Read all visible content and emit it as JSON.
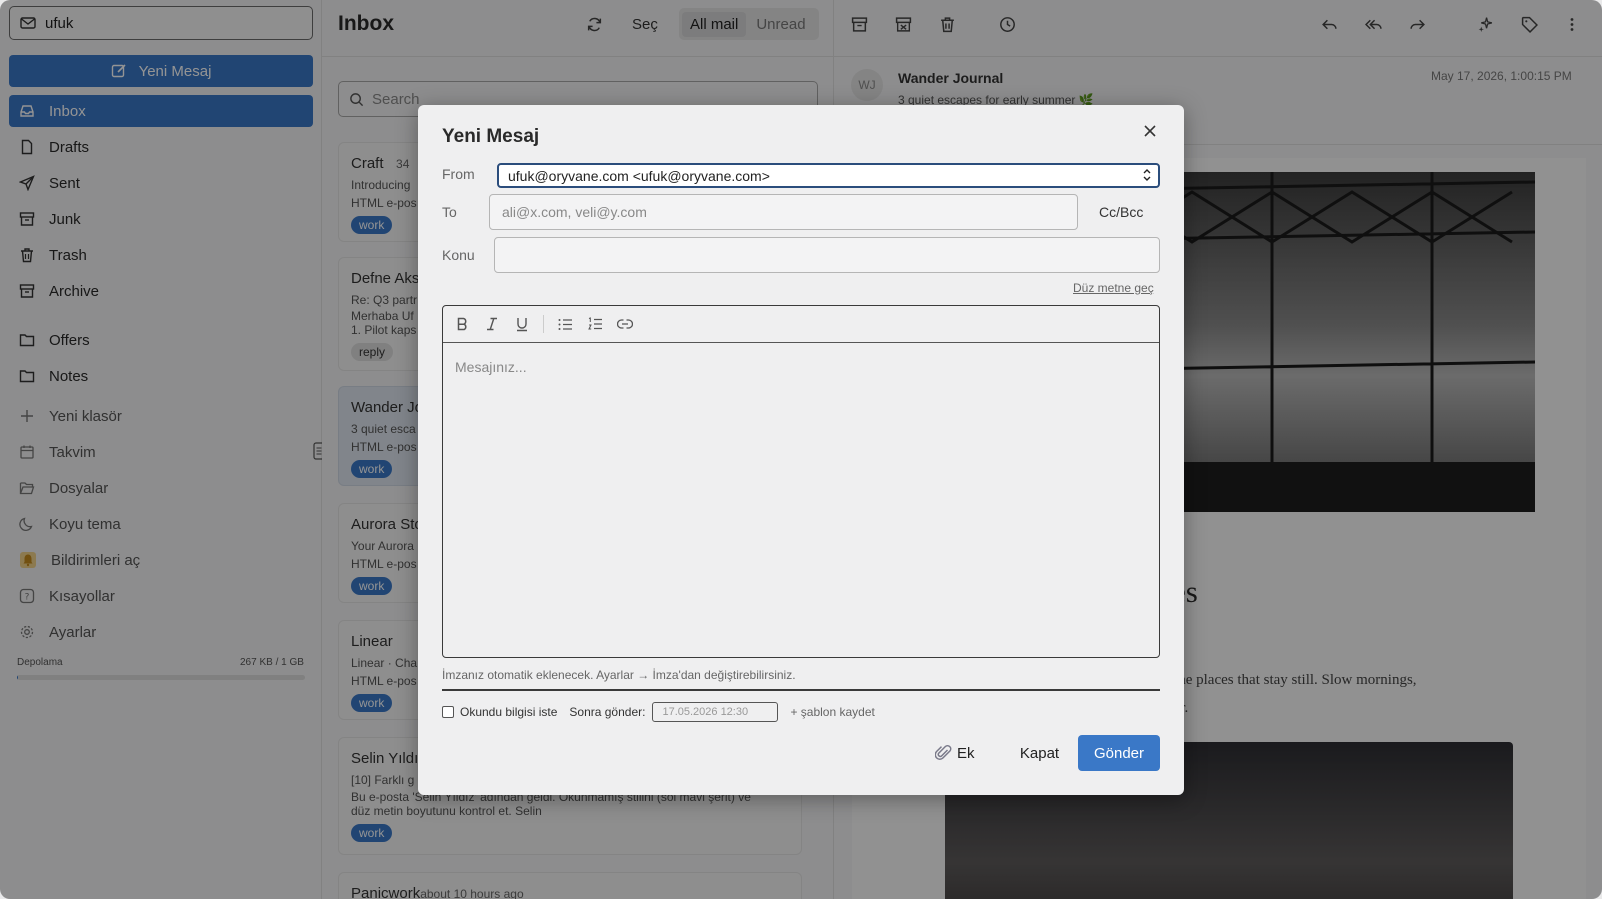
{
  "sidebar": {
    "account": "ufuk",
    "compose_label": "Yeni Mesaj",
    "folders": [
      {
        "label": "Inbox",
        "icon": "inbox-icon"
      },
      {
        "label": "Drafts",
        "icon": "file-icon"
      },
      {
        "label": "Sent",
        "icon": "send-icon"
      },
      {
        "label": "Junk",
        "icon": "junk-icon"
      },
      {
        "label": "Trash",
        "icon": "trash-icon"
      },
      {
        "label": "Archive",
        "icon": "archive-icon"
      }
    ],
    "custom_folders": [
      {
        "label": "Offers",
        "icon": "folder-icon"
      },
      {
        "label": "Notes",
        "icon": "folder-icon"
      }
    ],
    "actions": [
      {
        "label": "Yeni klasör",
        "icon": "plus-icon"
      },
      {
        "label": "Takvim",
        "icon": "calendar-icon"
      },
      {
        "label": "Dosyalar",
        "icon": "folder-open-icon"
      },
      {
        "label": "Koyu tema",
        "icon": "moon-icon"
      },
      {
        "label": "Bildirimleri aç",
        "icon": "bell-icon"
      },
      {
        "label": "Kısayollar",
        "icon": "help-icon"
      },
      {
        "label": "Ayarlar",
        "icon": "gear-icon"
      }
    ],
    "storage_label": "Depolama",
    "storage_value": "267 KB / 1 GB",
    "storage_fraction": 0.0003
  },
  "list": {
    "title": "Inbox",
    "select_label": "Seç",
    "filter_all": "All mail",
    "filter_unread": "Unread",
    "search_placeholder": "Search",
    "messages": [
      {
        "sender": "Craft",
        "meta": "34",
        "line1": "Introducing",
        "line2": "HTML e-pos",
        "tag": "work"
      },
      {
        "sender": "Defne Aks",
        "line1": "Re: Q3 partr",
        "line2": "Merhaba Uf",
        "line3": "1. Pilot kaps",
        "tag": "reply"
      },
      {
        "sender": "Wander Jo",
        "line1": "3 quiet esca",
        "line2": "HTML e-pos",
        "tag": "work"
      },
      {
        "sender": "Aurora Sto",
        "line1": "Your Aurora",
        "line2": "HTML e-pos",
        "tag": "work"
      },
      {
        "sender": "Linear",
        "line1": "Linear · Cha",
        "line2": "HTML e-pos",
        "tag": "work"
      },
      {
        "sender": "Selin Yıldız",
        "line1": "[10] Farklı g",
        "line2": "Bu e-posta 'Selin Yıldız' adından geldi. Okunmamış stilini (sol mavi şerit) ve",
        "line3": "düz metin boyutunu kontrol et. Selin",
        "tag": "work"
      },
      {
        "sender": "Panicwork",
        "meta": "about 10 hours ago"
      }
    ]
  },
  "reader": {
    "avatar": "WJ",
    "from": "Wander Journal",
    "subject": "3 quiet escapes for early summer 🌿",
    "date": "May 17, 2026, 1:00:15 PM",
    "title_fragment": "es",
    "body_line1": "are the places that stay still. Slow mornings,",
    "body_line2": "water."
  },
  "compose": {
    "title": "Yeni Mesaj",
    "from_label": "From",
    "from_value": "ufuk@oryvane.com <ufuk@oryvane.com>",
    "to_label": "To",
    "to_placeholder": "ali@x.com, veli@y.com",
    "ccbcc": "Cc/Bcc",
    "subject_label": "Konu",
    "subject_value": "",
    "plain_link": "Düz metne geç",
    "body_placeholder": "Mesajınız...",
    "signature_note": "İmzanız otomatik eklenecek. Ayarlar → İmza'dan değiştirebilirsiniz.",
    "read_receipt_label": "Okundu bilgisi iste",
    "schedule_label": "Sonra gönder:",
    "schedule_value": "17.05.2026 12:30",
    "save_template": "+ şablon kaydet",
    "attach_label": "Ek",
    "close_label": "Kapat",
    "send_label": "Gönder"
  },
  "colors": {
    "accent": "#3a78c7",
    "overlay": "rgba(0,0,0,0.42)"
  }
}
